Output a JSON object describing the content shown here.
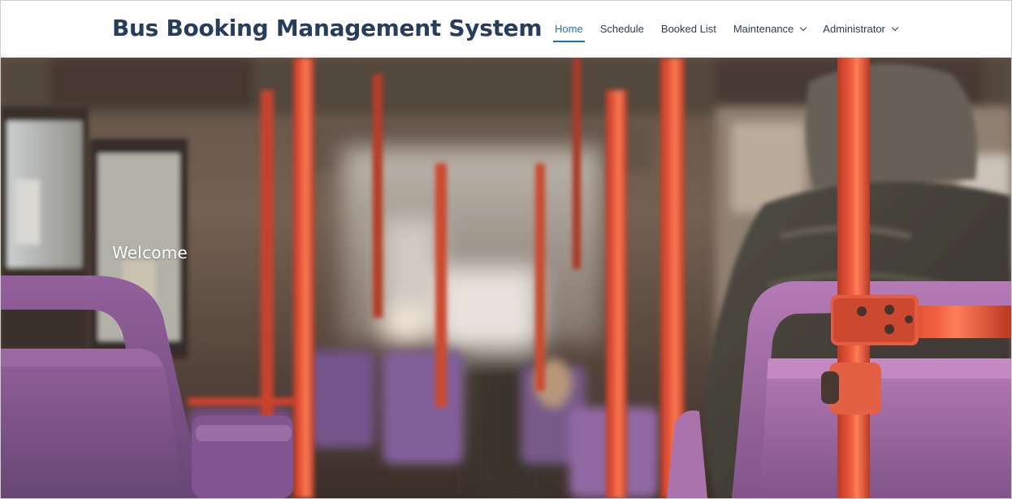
{
  "header": {
    "brand": "Bus Booking Management System",
    "nav": [
      {
        "label": "Home",
        "active": true,
        "dropdown": false
      },
      {
        "label": "Schedule",
        "active": false,
        "dropdown": false
      },
      {
        "label": "Booked List",
        "active": false,
        "dropdown": false
      },
      {
        "label": "Maintenance",
        "active": false,
        "dropdown": true
      },
      {
        "label": "Administrator",
        "active": false,
        "dropdown": true
      }
    ]
  },
  "hero": {
    "welcome": "Welcome",
    "image": "bus-interior-photo"
  },
  "colors": {
    "brand": "#263e5c",
    "nav_active": "#1f6fb5",
    "nav_text": "#2d3e50"
  }
}
